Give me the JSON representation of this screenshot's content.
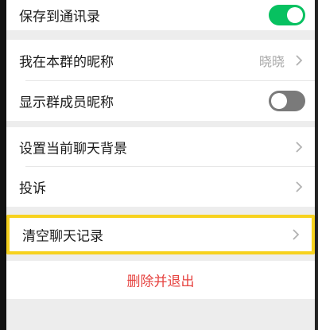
{
  "settings": {
    "save_to_contacts": {
      "label": "保存到通讯录",
      "toggle": "on"
    },
    "my_group_nickname": {
      "label": "我在本群的昵称",
      "value": "晓晓"
    },
    "show_member_nicknames": {
      "label": "显示群成员昵称",
      "toggle": "off"
    },
    "set_chat_background": {
      "label": "设置当前聊天背景"
    },
    "complain": {
      "label": "投诉"
    },
    "clear_chat_history": {
      "label": "清空聊天记录"
    },
    "delete_and_exit": {
      "label": "删除并退出"
    }
  },
  "colors": {
    "toggle_on": "#07c160",
    "toggle_off": "#7a7a7a",
    "danger": "#e64340",
    "highlight": "#f7d21e"
  },
  "icons": {
    "chevron": "chevron-right-icon"
  }
}
